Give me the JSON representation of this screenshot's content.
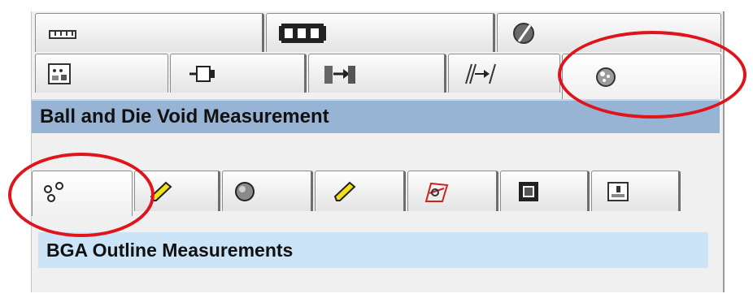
{
  "section_header": "Ball and Die Void Measurement",
  "sub_header": "BGA Outline Measurements",
  "tabs_row1": [
    {
      "icon": "ruler-icon"
    },
    {
      "icon": "film-strip-icon"
    },
    {
      "icon": "ball-slash-icon"
    }
  ],
  "tabs_row2": [
    {
      "icon": "image-adjust-icon"
    },
    {
      "icon": "pin-connector-icon"
    },
    {
      "icon": "align-arrow-icon"
    },
    {
      "icon": "skew-arrow-icon"
    },
    {
      "icon": "ball-void-icon",
      "selected": true
    }
  ],
  "tabs_row3": [
    {
      "icon": "ball-outline-icon",
      "selected": true
    },
    {
      "icon": "pencil-icon"
    },
    {
      "icon": "ball-icon"
    },
    {
      "icon": "pencil-icon"
    },
    {
      "icon": "die-void-icon"
    },
    {
      "icon": "chip-icon"
    },
    {
      "icon": "package-icon"
    }
  ],
  "colors": {
    "header_bg": "#98b4d4",
    "subheader_bg": "#cce4f7",
    "highlight_ring": "#e0151b",
    "pencil": "#f2e01a"
  }
}
